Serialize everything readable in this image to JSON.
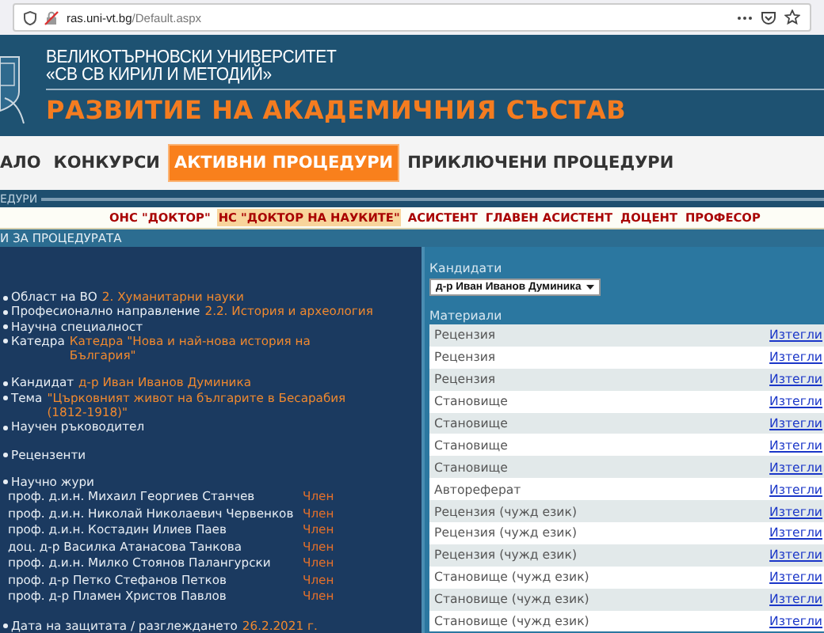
{
  "browser": {
    "url_domain": "ras.uni-vt.bg",
    "url_path": "/Default.aspx"
  },
  "header": {
    "university": [
      "ВЕЛИКОТЪРНОВСКИ УНИВЕРСИТЕТ",
      "«СВ СВ КИРИЛ И МЕТОДИЙ»"
    ],
    "title": "РАЗВИТИЕ НА АКАДЕМИЧНИЯ СЪСТАВ"
  },
  "nav": [
    {
      "label": "АЛО",
      "selected": false
    },
    {
      "label": "КОНКУРСИ",
      "selected": false
    },
    {
      "label": "АКТИВНИ ПРОЦЕДУРИ",
      "selected": true
    },
    {
      "label": "ПРИКЛЮЧЕНИ ПРОЦЕДУРИ",
      "selected": false
    }
  ],
  "section_label": "ЕДУРИ",
  "degree_types": [
    {
      "label": "ОНС \"ДОКТОР\"",
      "selected": false
    },
    {
      "label": "НС \"ДОКТОР НА НАУКИТЕ\"",
      "selected": true
    },
    {
      "label": "АСИСТЕНТ",
      "selected": false
    },
    {
      "label": "ГЛАВЕН АСИСТЕНТ",
      "selected": false
    },
    {
      "label": "ДОЦЕНТ",
      "selected": false
    },
    {
      "label": "ПРОФЕСОР",
      "selected": false
    }
  ],
  "panel_title": "И ЗА ПРОЦЕДУРАТА",
  "details": {
    "groups": [
      [
        {
          "label": "Област на ВО",
          "value": "2. Хуманитарни науки"
        },
        {
          "label": "Професионално направление",
          "value": "2.2. История и археология"
        },
        {
          "label": "Научна специалност"
        },
        {
          "label": "Катедра",
          "value": "Катедра \"Нова и най-нова история на България\""
        }
      ],
      [
        {
          "label": "Кандидат",
          "value": "д-р Иван Иванов Думиника"
        },
        {
          "label": "Тема",
          "value": "\"Църковният живот на българите в Бесарабия (1812-1918)\""
        },
        {
          "label": "Научен ръководител"
        }
      ],
      [
        {
          "label": "Рецензенти"
        }
      ],
      [
        {
          "label": "Научно жури",
          "members": [
            {
              "name": "проф. д.и.н. Михаил Георгиев Станчев",
              "role": "Член"
            },
            {
              "name": "проф. д.и.н. Николай Николаевич Червенков",
              "role": "Член"
            },
            {
              "name": "проф. д.и.н. Костадин Илиев Паев",
              "role": "Член"
            },
            {
              "name": "доц. д-р Василка Атанасова Танкова",
              "role": "Член"
            },
            {
              "name": "проф. д.и.н. Милко Стоянов Палангурски",
              "role": "Член"
            },
            {
              "name": "проф. д-р Петко Стефанов Петков",
              "role": "Член"
            },
            {
              "name": "проф. д-р Пламен Христов Павлов",
              "role": "Член"
            }
          ]
        }
      ],
      [
        {
          "label": "Дата на защитата / разглеждането",
          "value": "26.2.2021 г."
        }
      ]
    ]
  },
  "candidates": {
    "label": "Кандидати",
    "value": "д-р Иван Иванов Думиника"
  },
  "materials": {
    "label": "Материали",
    "rows": [
      {
        "name": "Рецензия",
        "link": "Изтегли"
      },
      {
        "name": "Рецензия",
        "link": "Изтегли"
      },
      {
        "name": "Рецензия",
        "link": "Изтегли"
      },
      {
        "name": "Становище",
        "link": "Изтегли"
      },
      {
        "name": "Становище",
        "link": "Изтегли"
      },
      {
        "name": "Становище",
        "link": "Изтегли"
      },
      {
        "name": "Становище",
        "link": "Изтегли"
      },
      {
        "name": "Автореферат",
        "link": "Изтегли"
      },
      {
        "name": "Рецензия (чужд език)",
        "link": "Изтегли"
      },
      {
        "name": "Рецензия (чужд език)",
        "link": "Изтегли"
      },
      {
        "name": "Рецензия (чужд език)",
        "link": "Изтегли"
      },
      {
        "name": "Становище (чужд език)",
        "link": "Изтегли"
      },
      {
        "name": "Становище (чужд език)",
        "link": "Изтегли"
      },
      {
        "name": "Становище (чужд език)",
        "link": "Изтегли"
      }
    ]
  }
}
